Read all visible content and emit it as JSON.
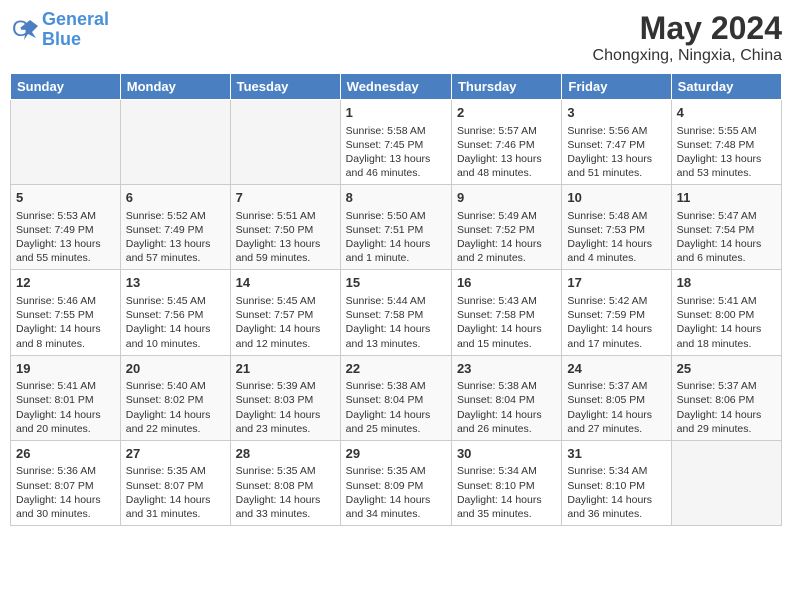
{
  "header": {
    "logo_line1": "General",
    "logo_line2": "Blue",
    "month_year": "May 2024",
    "location": "Chongxing, Ningxia, China"
  },
  "weekdays": [
    "Sunday",
    "Monday",
    "Tuesday",
    "Wednesday",
    "Thursday",
    "Friday",
    "Saturday"
  ],
  "weeks": [
    [
      {
        "day": "",
        "info": ""
      },
      {
        "day": "",
        "info": ""
      },
      {
        "day": "",
        "info": ""
      },
      {
        "day": "1",
        "info": "Sunrise: 5:58 AM\nSunset: 7:45 PM\nDaylight: 13 hours\nand 46 minutes."
      },
      {
        "day": "2",
        "info": "Sunrise: 5:57 AM\nSunset: 7:46 PM\nDaylight: 13 hours\nand 48 minutes."
      },
      {
        "day": "3",
        "info": "Sunrise: 5:56 AM\nSunset: 7:47 PM\nDaylight: 13 hours\nand 51 minutes."
      },
      {
        "day": "4",
        "info": "Sunrise: 5:55 AM\nSunset: 7:48 PM\nDaylight: 13 hours\nand 53 minutes."
      }
    ],
    [
      {
        "day": "5",
        "info": "Sunrise: 5:53 AM\nSunset: 7:49 PM\nDaylight: 13 hours\nand 55 minutes."
      },
      {
        "day": "6",
        "info": "Sunrise: 5:52 AM\nSunset: 7:49 PM\nDaylight: 13 hours\nand 57 minutes."
      },
      {
        "day": "7",
        "info": "Sunrise: 5:51 AM\nSunset: 7:50 PM\nDaylight: 13 hours\nand 59 minutes."
      },
      {
        "day": "8",
        "info": "Sunrise: 5:50 AM\nSunset: 7:51 PM\nDaylight: 14 hours\nand 1 minute."
      },
      {
        "day": "9",
        "info": "Sunrise: 5:49 AM\nSunset: 7:52 PM\nDaylight: 14 hours\nand 2 minutes."
      },
      {
        "day": "10",
        "info": "Sunrise: 5:48 AM\nSunset: 7:53 PM\nDaylight: 14 hours\nand 4 minutes."
      },
      {
        "day": "11",
        "info": "Sunrise: 5:47 AM\nSunset: 7:54 PM\nDaylight: 14 hours\nand 6 minutes."
      }
    ],
    [
      {
        "day": "12",
        "info": "Sunrise: 5:46 AM\nSunset: 7:55 PM\nDaylight: 14 hours\nand 8 minutes."
      },
      {
        "day": "13",
        "info": "Sunrise: 5:45 AM\nSunset: 7:56 PM\nDaylight: 14 hours\nand 10 minutes."
      },
      {
        "day": "14",
        "info": "Sunrise: 5:45 AM\nSunset: 7:57 PM\nDaylight: 14 hours\nand 12 minutes."
      },
      {
        "day": "15",
        "info": "Sunrise: 5:44 AM\nSunset: 7:58 PM\nDaylight: 14 hours\nand 13 minutes."
      },
      {
        "day": "16",
        "info": "Sunrise: 5:43 AM\nSunset: 7:58 PM\nDaylight: 14 hours\nand 15 minutes."
      },
      {
        "day": "17",
        "info": "Sunrise: 5:42 AM\nSunset: 7:59 PM\nDaylight: 14 hours\nand 17 minutes."
      },
      {
        "day": "18",
        "info": "Sunrise: 5:41 AM\nSunset: 8:00 PM\nDaylight: 14 hours\nand 18 minutes."
      }
    ],
    [
      {
        "day": "19",
        "info": "Sunrise: 5:41 AM\nSunset: 8:01 PM\nDaylight: 14 hours\nand 20 minutes."
      },
      {
        "day": "20",
        "info": "Sunrise: 5:40 AM\nSunset: 8:02 PM\nDaylight: 14 hours\nand 22 minutes."
      },
      {
        "day": "21",
        "info": "Sunrise: 5:39 AM\nSunset: 8:03 PM\nDaylight: 14 hours\nand 23 minutes."
      },
      {
        "day": "22",
        "info": "Sunrise: 5:38 AM\nSunset: 8:04 PM\nDaylight: 14 hours\nand 25 minutes."
      },
      {
        "day": "23",
        "info": "Sunrise: 5:38 AM\nSunset: 8:04 PM\nDaylight: 14 hours\nand 26 minutes."
      },
      {
        "day": "24",
        "info": "Sunrise: 5:37 AM\nSunset: 8:05 PM\nDaylight: 14 hours\nand 27 minutes."
      },
      {
        "day": "25",
        "info": "Sunrise: 5:37 AM\nSunset: 8:06 PM\nDaylight: 14 hours\nand 29 minutes."
      }
    ],
    [
      {
        "day": "26",
        "info": "Sunrise: 5:36 AM\nSunset: 8:07 PM\nDaylight: 14 hours\nand 30 minutes."
      },
      {
        "day": "27",
        "info": "Sunrise: 5:35 AM\nSunset: 8:07 PM\nDaylight: 14 hours\nand 31 minutes."
      },
      {
        "day": "28",
        "info": "Sunrise: 5:35 AM\nSunset: 8:08 PM\nDaylight: 14 hours\nand 33 minutes."
      },
      {
        "day": "29",
        "info": "Sunrise: 5:35 AM\nSunset: 8:09 PM\nDaylight: 14 hours\nand 34 minutes."
      },
      {
        "day": "30",
        "info": "Sunrise: 5:34 AM\nSunset: 8:10 PM\nDaylight: 14 hours\nand 35 minutes."
      },
      {
        "day": "31",
        "info": "Sunrise: 5:34 AM\nSunset: 8:10 PM\nDaylight: 14 hours\nand 36 minutes."
      },
      {
        "day": "",
        "info": ""
      }
    ]
  ]
}
